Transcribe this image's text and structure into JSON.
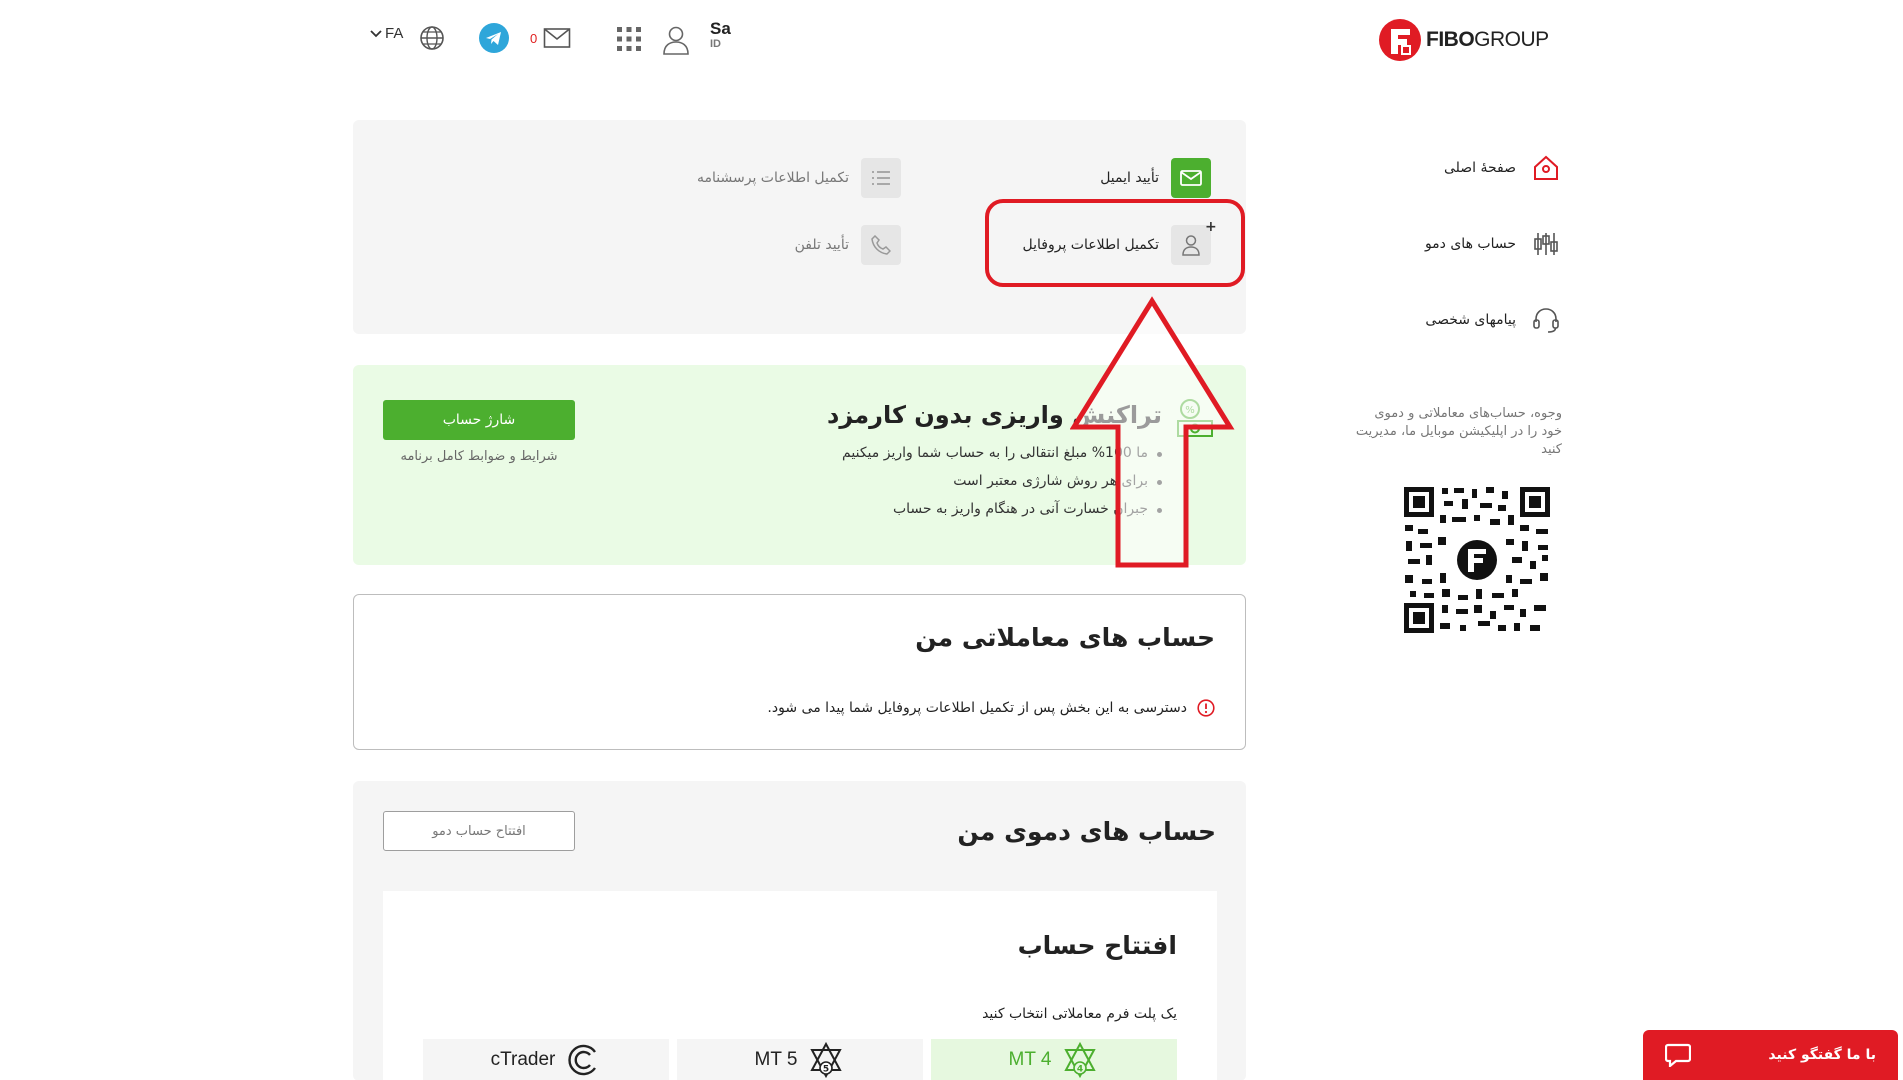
{
  "header": {
    "brand_bold": "FIBO",
    "brand_rest": "GROUP",
    "user_name": "Sa",
    "user_sub": "ID",
    "message_count": "0",
    "language": "FA"
  },
  "sidebar": {
    "items": [
      {
        "label": "صفحهٔ اصلی",
        "icon": "home-icon"
      },
      {
        "label": "حساب های دمو",
        "icon": "candlestick-icon"
      },
      {
        "label": "پیامهای شخصی",
        "icon": "headset-icon"
      }
    ],
    "note": "وجوه، حساب‌های معاملاتی و دموی خود را در اپلیکیشن موبایل ما، مدیریت کنید"
  },
  "steps": {
    "email": "تأیید ایمیل",
    "questionnaire": "تکمیل اطلاعات پرسشنامه",
    "profile": "تکمیل اطلاعات پروفایل",
    "phone": "تأیید تلفن"
  },
  "promo": {
    "title": "تراکنش واریزی بدون کارمزد",
    "bullets": [
      "ما 100% مبلغ انتقالی را به حساب شما واریز میکنیم",
      "برای هر روش شارژی معتبر است",
      "جبران خسارت آنی در هنگام واریز به حساب"
    ],
    "button": "شارژ حساب",
    "terms": "شرایط و ضوابط کامل برنامه"
  },
  "trading": {
    "title": "حساب های معاملاتی من",
    "notice": "دسترسی به این بخش پس از تکمیل اطلاعات پروفایل شما پیدا می شود."
  },
  "demo": {
    "title": "حساب های دموی من",
    "open_button": "افتتاح حساب دمو",
    "open_title": "افتتاح حساب",
    "choose_label": "یک پلت فرم معاملاتی انتخاب کنید",
    "platforms": [
      {
        "label": "MT 4",
        "badge": "4"
      },
      {
        "label": "MT 5",
        "badge": "5"
      },
      {
        "label": "cTrader"
      }
    ]
  },
  "chat": {
    "label": "با ما گفتگو کنید"
  },
  "colors": {
    "brand_red": "#e01b24",
    "accent_green": "#4caf2f",
    "promo_bg": "#eafbe5"
  }
}
